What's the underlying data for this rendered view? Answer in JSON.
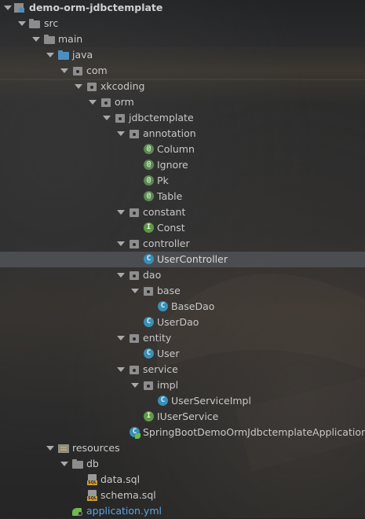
{
  "tree": {
    "root": "demo-orm-jdbctemplate",
    "src": "src",
    "main": "main",
    "java": "java",
    "com": "com",
    "xkcoding": "xkcoding",
    "orm": "orm",
    "jdbctemplate": "jdbctemplate",
    "annotation": "annotation",
    "annotation_items": [
      "Column",
      "Ignore",
      "Pk",
      "Table"
    ],
    "constant": "constant",
    "const": "Const",
    "controller": "controller",
    "user_controller": "UserController",
    "dao": "dao",
    "base": "base",
    "base_dao": "BaseDao",
    "user_dao": "UserDao",
    "entity": "entity",
    "user": "User",
    "service": "service",
    "impl": "impl",
    "user_service_impl": "UserServiceImpl",
    "iuser_service": "IUserService",
    "app_class": "SpringBootDemoOrmJdbctemplateApplication",
    "resources": "resources",
    "db": "db",
    "data_sql": "data.sql",
    "schema_sql": "schema.sql",
    "application_yml": "application.yml"
  },
  "badges": {
    "annotation": "@",
    "class": "C",
    "interface": "I"
  },
  "colors": {
    "selected_row": "#505256",
    "link_text": "#5aa5e3",
    "class_badge": "#3a8fb7",
    "annotation_badge": "#5a8a52",
    "interface_badge": "#5e9a46"
  }
}
